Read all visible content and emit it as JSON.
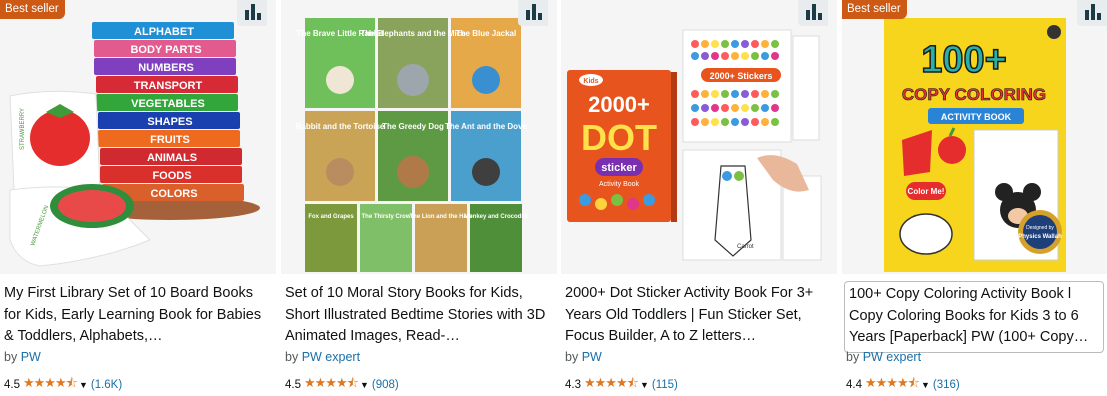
{
  "products": [
    {
      "badge": "Best seller",
      "title": "My First Library Set of 10 Board Books for Kids, Early Learning Book for Babies & Toddlers, Alphabets,…",
      "by_prefix": "by",
      "author": "PW",
      "rating": "4.5",
      "reviews": "(1.6K)",
      "image": {
        "spines": [
          "ALPHABET",
          "BODY PARTS",
          "NUMBERS",
          "TRANSPORT",
          "VEGETABLES",
          "SHAPES",
          "FRUITS",
          "ANIMALS",
          "FOODS",
          "COLORS"
        ],
        "card_label_top": "STRAWBERRY",
        "card_label_bottom": "WATERMELON"
      }
    },
    {
      "badge": "",
      "title": "Set of 10 Moral Story Books for Kids, Short Illustrated Bedtime Stories with 3D Animated Images, Read-…",
      "by_prefix": "by",
      "author": "PW expert",
      "rating": "4.5",
      "reviews": "(908)",
      "image": {
        "books": [
          "The Brave Little Rabbit",
          "The Elephants and the Mice",
          "The Blue Jackal",
          "Rabbit and the Tortoise",
          "The Greedy Dog",
          "The Ant and the Dove",
          "Fox and Grapes",
          "The Thirsty Crow",
          "The Lion and the Hare",
          "Monkey and Crocodile"
        ]
      }
    },
    {
      "badge": "",
      "title": "2000+ Dot Sticker Activity Book For 3+ Years Old Toddlers | Fun Sticker Set, Focus Builder, A to Z letters…",
      "by_prefix": "by",
      "author": "PW",
      "rating": "4.3",
      "reviews": "(115)",
      "image": {
        "brand": "Kids",
        "big_number": "2000+",
        "word1": "DOT",
        "word2": "sticker",
        "word3": "Activity Book",
        "sheet_label": "2000+ Stickers",
        "page_caption": "Carrot"
      }
    },
    {
      "badge": "Best seller",
      "title": "100+ Copy Coloring Activity Book l Copy Coloring Books for Kids 3 to 6 Years [Paperback] PW (100+ Copy…",
      "by_prefix": "by",
      "author": "PW expert",
      "rating": "4.4",
      "reviews": "(316)",
      "image": {
        "headline": "100+",
        "line1": "COPY COLORING",
        "line2": "ACTIVITY BOOK",
        "bubble": "Color Me!",
        "seal_top": "Designed by",
        "seal_bottom": "Physics Wallah"
      }
    }
  ],
  "stars_glyph": "★★★★⯪",
  "colors": {
    "badge": "#cc5914",
    "star": "#de7921",
    "link": "#1a6fa8"
  }
}
